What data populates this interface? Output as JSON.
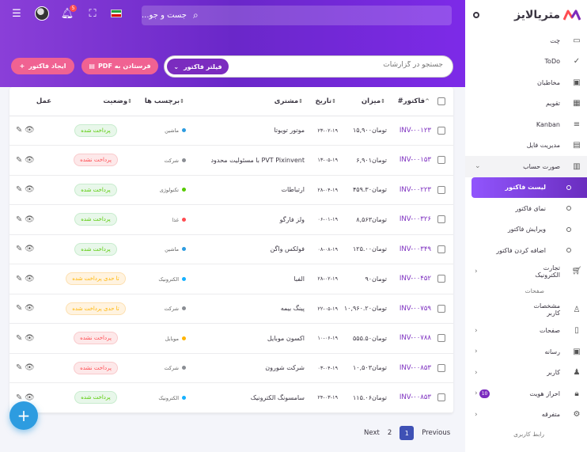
{
  "brand": {
    "name": "متریالایز"
  },
  "topbar": {
    "search_placeholder": "جست و جو..."
  },
  "notifications": {
    "count": "5"
  },
  "flag_colors": [
    "#239f40",
    "#ffffff",
    "#da0000"
  ],
  "sidebar": {
    "items": [
      {
        "label": "چت",
        "icon": "chat-icon"
      },
      {
        "label": "ToDo",
        "icon": "check-icon"
      },
      {
        "label": "مخاطبان",
        "icon": "contacts-icon"
      },
      {
        "label": "تقویم",
        "icon": "calendar-icon"
      },
      {
        "label": "Kanban",
        "icon": "kanban-icon"
      },
      {
        "label": "مدیریت فایل",
        "icon": "file-icon"
      },
      {
        "label": "صورت حساب",
        "icon": "receipt-icon"
      }
    ],
    "sub_items": [
      {
        "label": "لیست فاکتور",
        "active": true
      },
      {
        "label": "نمای فاکتور"
      },
      {
        "label": "ویرایش فاکتور"
      },
      {
        "label": "اضافه کردن فاکتور"
      }
    ],
    "ecommerce": {
      "label": "تجارت الکترونیک"
    },
    "section_pages": "صفحات",
    "pages_items": [
      {
        "label": "مشخصات کاربر"
      },
      {
        "label": "صفحات"
      },
      {
        "label": "رسانه"
      },
      {
        "label": "کاربر"
      },
      {
        "label": "احراز هویت",
        "badge": "10"
      },
      {
        "label": "متفرقه"
      }
    ],
    "section_ui": "رابط کاربری"
  },
  "toolbar": {
    "search_placeholder": "جستجو در گزارشات",
    "filter_label": "فیلتر فاکتور",
    "pdf_label": "فرستادن به PDF",
    "create_label": "ایجاد فاکتور"
  },
  "table": {
    "headers": {
      "invoice": "فاکتور#",
      "amount": "میزان",
      "date": "تاریخ",
      "customer": "مشتری",
      "tag": "برچسب ها",
      "status": "وضعیت",
      "action": "عمل"
    },
    "rows": [
      {
        "invoice": "INV-۰۰۱۲۳",
        "amount": "تومان۱۵,۹۰۰",
        "date": "۲۳-۰۲-۱۹",
        "customer": "موتور تویوتا",
        "tag": "ماشین",
        "tag_color": "#2d9ce0",
        "status": "پرداخت شده",
        "status_type": "paid"
      },
      {
        "invoice": "INV-۰۰۱۵۳",
        "amount": "تومان۶,۹۰۱",
        "date": "۱۳-۰۵-۱۹",
        "customer": "PVT Pixinvent با مسئولیت محدود",
        "tag": "شرکت",
        "tag_color": "#8a8d93",
        "status": "پرداخت نشده",
        "status_type": "unpaid"
      },
      {
        "invoice": "INV-۰۰۲۲۳",
        "amount": "تومان۴۵۹.۳۰",
        "date": "۲۸-۰۴-۱۹",
        "customer": "ارتباطات",
        "tag": "تکنولوژی",
        "tag_color": "#56ca00",
        "status": "پرداخت شده",
        "status_type": "paid"
      },
      {
        "invoice": "INV-۰۰۳۲۶",
        "amount": "تومان۸,۵۶۳",
        "date": "۰۶-۰۱-۱۹",
        "customer": "ولز فارگو",
        "tag": "غذا",
        "tag_color": "#ff4c51",
        "status": "پرداخت شده",
        "status_type": "paid"
      },
      {
        "invoice": "INV-۰۰۳۴۹",
        "amount": "تومان۱۲۵.۰۰",
        "date": "۰۸-۰۸-۱۹",
        "customer": "فولکس واگن",
        "tag": "ماشین",
        "tag_color": "#2d9ce0",
        "status": "پرداخت شده",
        "status_type": "paid"
      },
      {
        "invoice": "INV-۰۰۴۵۲",
        "amount": "تومان۹۰",
        "date": "۲۸-۰۲-۱۹",
        "customer": "الفبا",
        "tag": "الکترونیک",
        "tag_color": "#16b1ff",
        "status": "تا حدی پرداخت شده",
        "status_type": "partial"
      },
      {
        "invoice": "INV-۰۰۷۵۹",
        "amount": "تومان۱۰,۹۶۰.۲۰",
        "date": "۲۲-۰۵-۱۹",
        "customer": "پینگ بیمه",
        "tag": "شرکت",
        "tag_color": "#8a8d93",
        "status": "تا حدی پرداخت شده",
        "status_type": "partial"
      },
      {
        "invoice": "INV-۰۰۷۸۸",
        "amount": "تومان۵۵۵.۵۰",
        "date": "۱۰-۰۶-۱۹",
        "customer": "اکسون موبایل",
        "tag": "موبایل",
        "tag_color": "#ffb400",
        "status": "پرداخت نشده",
        "status_type": "unpaid"
      },
      {
        "invoice": "INV-۰۰۸۵۳",
        "amount": "تومان۱۰,۵۰۳",
        "date": "۰۳-۰۴-۱۹",
        "customer": "شرکت شورون",
        "tag": "شرکت",
        "tag_color": "#8a8d93",
        "status": "پرداخت نشده",
        "status_type": "unpaid"
      },
      {
        "invoice": "INV-۰۰۸۵۳",
        "amount": "تومان۱۱۵.۰۶",
        "date": "۲۴-۰۳-۱۹",
        "customer": "سامسونگ الکترونیک",
        "tag": "الکترونیک",
        "tag_color": "#16b1ff",
        "status": "پرداخت شده",
        "status_type": "paid"
      }
    ]
  },
  "pagination": {
    "previous": "Previous",
    "next": "Next",
    "pages": [
      "1",
      "2"
    ],
    "current": "1"
  }
}
